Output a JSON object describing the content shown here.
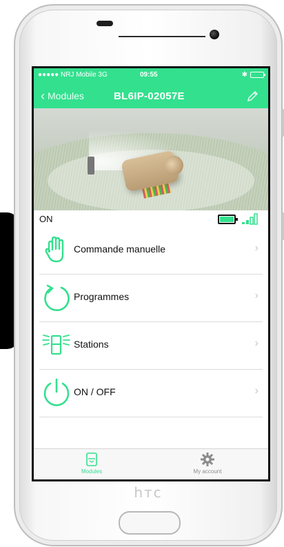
{
  "status_bar": {
    "carrier": "●●●●● NRJ Mobile  3G",
    "time": "09:55"
  },
  "nav": {
    "back_label": "Modules",
    "title": "BL6IP-02057E"
  },
  "device": {
    "state": "ON"
  },
  "menu": {
    "items": [
      {
        "label": "Commande manuelle",
        "icon": "hand-icon"
      },
      {
        "label": "Programmes",
        "icon": "refresh-icon"
      },
      {
        "label": "Stations",
        "icon": "station-icon"
      },
      {
        "label": "ON / OFF",
        "icon": "power-icon"
      }
    ]
  },
  "tabbar": {
    "modules_label": "Modules",
    "account_label": "My account"
  },
  "colors": {
    "accent": "#33e08e",
    "text": "#111111",
    "chevron": "#c7c7c7"
  }
}
